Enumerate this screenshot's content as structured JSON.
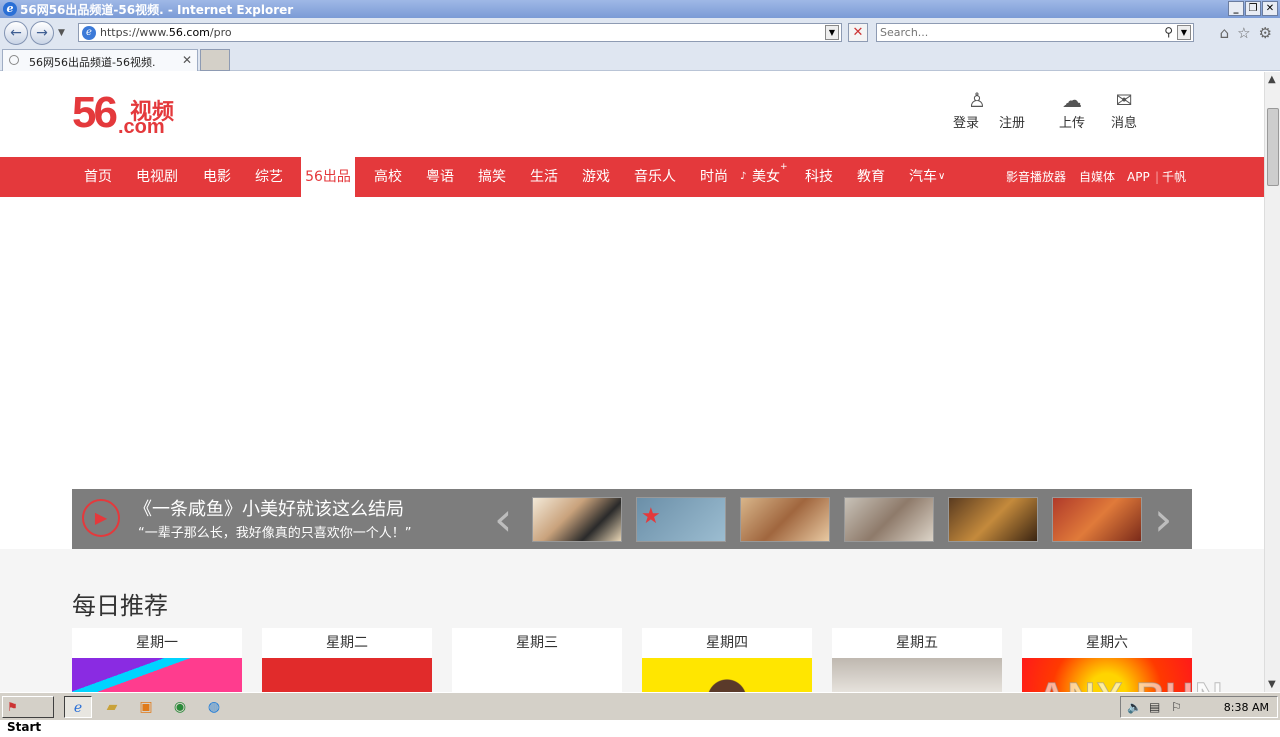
{
  "browser": {
    "title": "56网56出品频道-56视频. - Internet Explorer",
    "url_prefix": "https://www.",
    "url_domain": "56.com",
    "url_path": "/pro",
    "search_placeholder": "Search...",
    "tab_title": "56网56出品频道-56视频."
  },
  "site": {
    "logo_number": "56",
    "logo_text": "视频",
    "logo_domain": ".com",
    "user_actions": [
      {
        "label": "登录",
        "icon": "user-icon"
      },
      {
        "label": "注册",
        "icon": "user-icon"
      },
      {
        "label": "上传",
        "icon": "cloud-upload-icon"
      },
      {
        "label": "消息",
        "icon": "envelope-icon"
      }
    ],
    "nav": [
      "首页",
      "电视剧",
      "电影",
      "综艺",
      "56出品",
      "高校",
      "粤语",
      "搞笑",
      "生活",
      "游戏",
      "音乐人",
      "时尚",
      "美女",
      "科技",
      "教育",
      "汽车"
    ],
    "nav_active": "56出品",
    "nav_right": [
      "影音播放器",
      "自媒体",
      "APP",
      "千帆"
    ],
    "banner": {
      "title": "《一条咸鱼》小美好就该这么结局",
      "subtitle": "“一辈子那么长，我好像真的只喜欢你一个人！”"
    },
    "recommend_title": "每日推荐",
    "days": [
      "星期一",
      "星期二",
      "星期三",
      "星期四",
      "星期五",
      "星期六"
    ]
  },
  "watermark": "ANY RUN",
  "taskbar": {
    "start": "Start",
    "clock": "8:38 AM"
  }
}
